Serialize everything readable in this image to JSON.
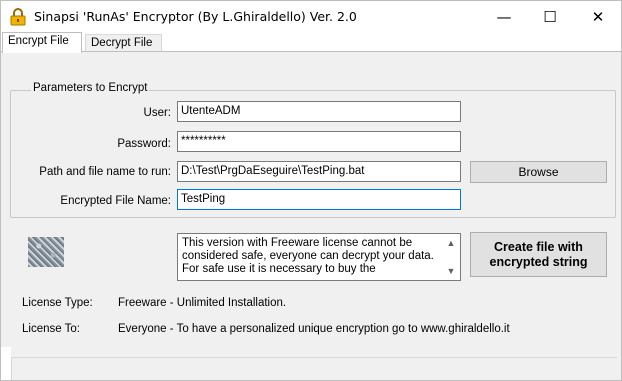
{
  "window": {
    "title": "Sinapsi 'RunAs' Encryptor (By L.Ghiraldello) Ver. 2.0",
    "minimize_glyph": "—",
    "maximize_glyph": "☐",
    "close_glyph": "✕",
    "icon": "lock-icon"
  },
  "tabs": [
    {
      "label": "Encrypt File",
      "active": true
    },
    {
      "label": "Decrypt File",
      "active": false
    }
  ],
  "group": {
    "title": "Parameters to Encrypt"
  },
  "fields": {
    "user": {
      "label": "User:",
      "value": "UtenteADM"
    },
    "password": {
      "label": "Password:",
      "value": "**********"
    },
    "path": {
      "label": "Path and file name to run:",
      "value": "D:\\Test\\PrgDaEseguire\\TestPing.bat"
    },
    "encrypted_name": {
      "label": "Encrypted File Name:",
      "value": "TestPing"
    }
  },
  "buttons": {
    "browse": "Browse",
    "create_line1": "Create file with",
    "create_line2": "encrypted string"
  },
  "info": {
    "text": "This version with Freeware license cannot be considered safe, everyone can decrypt your data. For safe use it is necessary to buy the",
    "scroll_up": "▲",
    "scroll_down": "▼"
  },
  "license": {
    "type_label": "License Type:",
    "type_value": "Freeware - Unlimited Installation.",
    "to_label": "License To:",
    "to_value": "Everyone - To have a personalized unique encryption go to www.ghiraldello.it"
  },
  "colors": {
    "accent": "#0078d7",
    "window_bg": "#f0f0f0",
    "button_bg": "#e1e1e1"
  }
}
